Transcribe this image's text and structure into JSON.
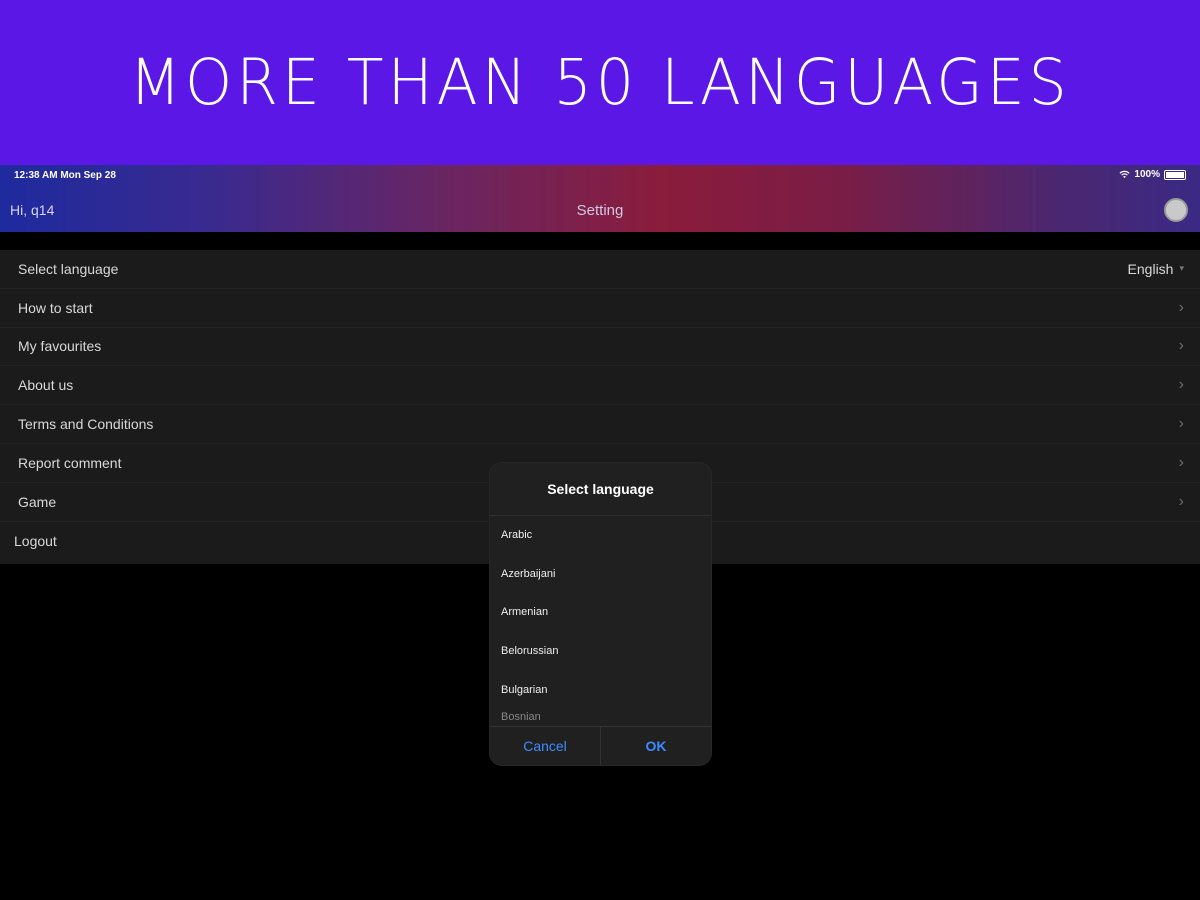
{
  "banner": {
    "title": "MORE THAN 50 LANGUAGES"
  },
  "status_bar": {
    "time": "12:38 AM  Mon Sep 28",
    "battery": "100%"
  },
  "header": {
    "greeting": "Hi, q14",
    "title": "Setting"
  },
  "settings": {
    "select_language": {
      "label": "Select language",
      "value": "English"
    },
    "items": [
      {
        "label": "How to start"
      },
      {
        "label": "My favourites"
      },
      {
        "label": "About us"
      },
      {
        "label": "Terms and Conditions"
      },
      {
        "label": "Report comment"
      },
      {
        "label": "Game"
      }
    ],
    "logout": "Logout"
  },
  "dialog": {
    "title": "Select language",
    "languages": [
      "Arabic",
      "Azerbaijani",
      "Armenian",
      "Belorussian",
      "Bulgarian",
      "Bosnian"
    ],
    "cancel": "Cancel",
    "ok": "OK"
  },
  "colors": {
    "banner_bg": "#5b17e6",
    "link_blue": "#3d8bff"
  }
}
